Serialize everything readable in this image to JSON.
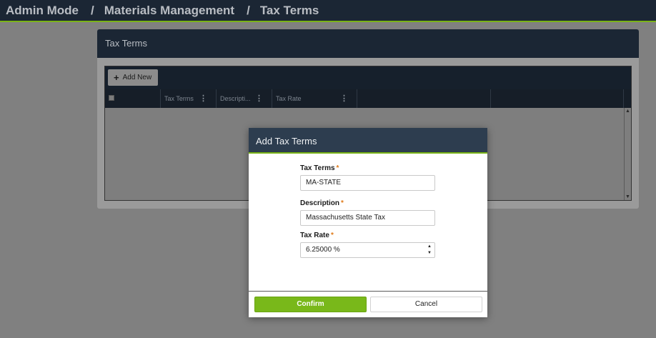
{
  "breadcrumb": {
    "items": [
      "Admin Mode",
      "Materials Management",
      "Tax Terms"
    ],
    "separator": "/"
  },
  "panel": {
    "title": "Tax Terms"
  },
  "grid": {
    "add_label": "Add New",
    "columns": [
      "Tax Terms",
      "Descripti...",
      "Tax Rate"
    ],
    "rows": []
  },
  "dialog": {
    "title": "Add Tax Terms",
    "fields": {
      "tax_terms": {
        "label": "Tax Terms",
        "value": "MA-STATE",
        "required": "*"
      },
      "description": {
        "label": "Description",
        "value": "Massachusetts State Tax",
        "required": "*"
      },
      "tax_rate": {
        "label": "Tax Rate",
        "value": "6.25000 %",
        "required": "*"
      }
    },
    "confirm_label": "Confirm",
    "cancel_label": "Cancel"
  },
  "icons": {
    "add": "plus-icon",
    "column_menu": "kebab-icon",
    "spinner_up": "caret-up-icon",
    "spinner_down": "caret-down-icon"
  },
  "colors": {
    "header_bg": "#1b2634",
    "accent": "#7ab317",
    "dialog_header": "#2d3d4f",
    "required": "#e07b1a"
  }
}
